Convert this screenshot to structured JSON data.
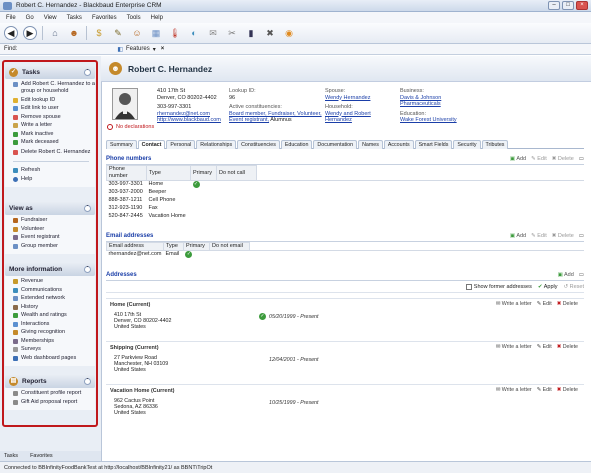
{
  "window": {
    "title": "Robert C. Hernandez - Blackbaud Enterprise CRM"
  },
  "menu": [
    "File",
    "Go",
    "View",
    "Tasks",
    "Favorites",
    "Tools",
    "Help"
  ],
  "findbar": {
    "label": "Find:",
    "features_label": "Features"
  },
  "left": {
    "tasks": {
      "title": "Tasks",
      "items": [
        "Add Robert C. Hernandez to a group or household",
        "Edit lookup ID",
        "Edit link to user",
        "Remove spouse",
        "Write a letter",
        "Mark inactive",
        "Mark deceased",
        "Delete Robert C. Hernandez"
      ],
      "refresh": "Refresh",
      "help": "Help"
    },
    "viewas": {
      "title": "View as",
      "items": [
        "Fundraiser",
        "Volunteer",
        "Event registrant",
        "Group member"
      ]
    },
    "moreinfo": {
      "title": "More information",
      "items": [
        "Revenue",
        "Communications",
        "Extended network",
        "History",
        "Wealth and ratings",
        "Interactions",
        "Giving recognition",
        "Memberships",
        "Surveys",
        "Web dashboard pages"
      ]
    },
    "reports": {
      "title": "Reports",
      "items": [
        "Constituent profile report",
        "Gift Aid proposal report"
      ]
    },
    "bottomtabs": [
      "Tasks",
      "Favorites"
    ]
  },
  "constituent": {
    "name": "Robert C. Hernandez",
    "address_line1": "410 17th St",
    "address_line2": "Denver, CO 80202-4402",
    "phone": "303-997-3301",
    "email": "rhernandez@net.com",
    "website": "http://www.blackbaud.com",
    "declarations": "No declarations",
    "lookup_label": "Lookup ID:",
    "lookup_value": "96",
    "active_label": "Active constituencies:",
    "constituencies": "Board member, Fundraiser, Volunteer,",
    "constituencies2": "Event registrant,",
    "constituencies2_tail": "Alumnus",
    "spouse_label": "Spouse:",
    "spouse": "Wendy Hernandez",
    "household_label": "Household:",
    "household": "Wendy and Robert Hernandez",
    "business_label": "Business:",
    "business": "Davis & Johnson Pharmaceuticals",
    "education_label": "Education:",
    "education": "Wake Forest University"
  },
  "tabs": [
    "Summary",
    "Contact",
    "Personal",
    "Relationships",
    "Constituencies",
    "Education",
    "Documentation",
    "Names",
    "Accounts",
    "Smart Fields",
    "Security",
    "Tributes"
  ],
  "actions": {
    "add": "Add",
    "edit": "Edit",
    "delete": "Delete",
    "apply": "Apply",
    "reset": "Reset",
    "write_letter": "Write a letter"
  },
  "phones": {
    "title": "Phone numbers",
    "columns": [
      "Phone number",
      "Type",
      "Primary",
      "Do not call"
    ],
    "rows": [
      {
        "number": "303-997-3301",
        "type": "Home",
        "primary": true
      },
      {
        "number": "303-937-2000",
        "type": "Beeper",
        "primary": false
      },
      {
        "number": "888-387-1211",
        "type": "Cell Phone",
        "primary": false
      },
      {
        "number": "312-923-1190",
        "type": "Fax",
        "primary": false
      },
      {
        "number": "520-847-2445",
        "type": "Vacation Home",
        "primary": false
      }
    ]
  },
  "emails": {
    "title": "Email addresses",
    "columns": [
      "Email address",
      "Type",
      "Primary",
      "Do not email"
    ],
    "rows": [
      {
        "address": "rhernandez@net.com",
        "type": "Email",
        "primary": true
      }
    ]
  },
  "addresses": {
    "title": "Addresses",
    "show_former": "Show former addresses",
    "items": [
      {
        "title": "Home (Current)",
        "lines": [
          "410 17th St",
          "Denver, CO 80202-4402",
          "United States"
        ],
        "dates": "05/20/1999 - Present",
        "primary": true
      },
      {
        "title": "Shipping (Current)",
        "lines": [
          "27 Parkview Road",
          "Manchester, NH 03109",
          "United States"
        ],
        "dates": "12/04/2001 - Present",
        "primary": false
      },
      {
        "title": "Vacation Home (Current)",
        "lines": [
          "962 Cactus Point",
          "Sedona, AZ 86336",
          "United States"
        ],
        "dates": "10/25/1999 - Present",
        "primary": false
      }
    ]
  },
  "status": "Connected to BBInfinityFoodBankTest at http://localhost/BBInfinity21/ as BBNT\\TripOt"
}
